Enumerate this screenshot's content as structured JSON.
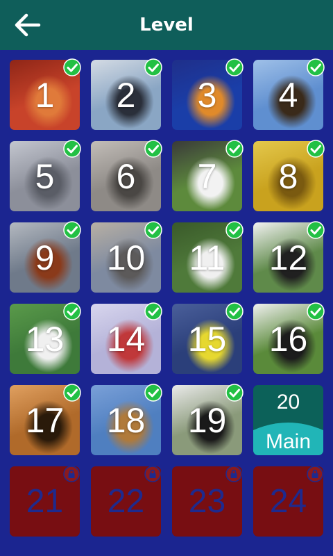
{
  "header": {
    "title": "Level",
    "back_icon": "arrow-left-icon",
    "background": "#0f5e5a"
  },
  "colors": {
    "page_background": "#1b2590",
    "check_badge": "#22c044",
    "locked_tile": "#780e12",
    "special_tile": "#0c6159",
    "special_wave": "#21b5b7"
  },
  "levels": [
    {
      "number": "1",
      "image": "red flower",
      "status": "completed"
    },
    {
      "number": "2",
      "image": "penguins",
      "status": "completed"
    },
    {
      "number": "3",
      "image": "jellyfish",
      "status": "completed"
    },
    {
      "number": "4",
      "image": "eagle",
      "status": "completed"
    },
    {
      "number": "5",
      "image": "koala",
      "status": "completed"
    },
    {
      "number": "6",
      "image": "tabby cat",
      "status": "completed"
    },
    {
      "number": "7",
      "image": "puppy",
      "status": "completed"
    },
    {
      "number": "8",
      "image": "tulips",
      "status": "completed"
    },
    {
      "number": "9",
      "image": "rooster",
      "status": "completed"
    },
    {
      "number": "10",
      "image": "elephant",
      "status": "completed"
    },
    {
      "number": "11",
      "image": "duck",
      "status": "completed"
    },
    {
      "number": "12",
      "image": "cow",
      "status": "completed"
    },
    {
      "number": "13",
      "image": "rabbit",
      "status": "completed"
    },
    {
      "number": "14",
      "image": "crab",
      "status": "completed"
    },
    {
      "number": "15",
      "image": "yellow bird",
      "status": "completed"
    },
    {
      "number": "16",
      "image": "panda",
      "status": "completed"
    },
    {
      "number": "17",
      "image": "tiger",
      "status": "completed"
    },
    {
      "number": "18",
      "image": "giraffes",
      "status": "completed"
    },
    {
      "number": "19",
      "image": "zebra",
      "status": "completed"
    },
    {
      "number": "20",
      "label": "Main",
      "status": "current"
    },
    {
      "number": "21",
      "status": "locked"
    },
    {
      "number": "22",
      "status": "locked"
    },
    {
      "number": "23",
      "status": "locked"
    },
    {
      "number": "24",
      "status": "locked"
    }
  ]
}
